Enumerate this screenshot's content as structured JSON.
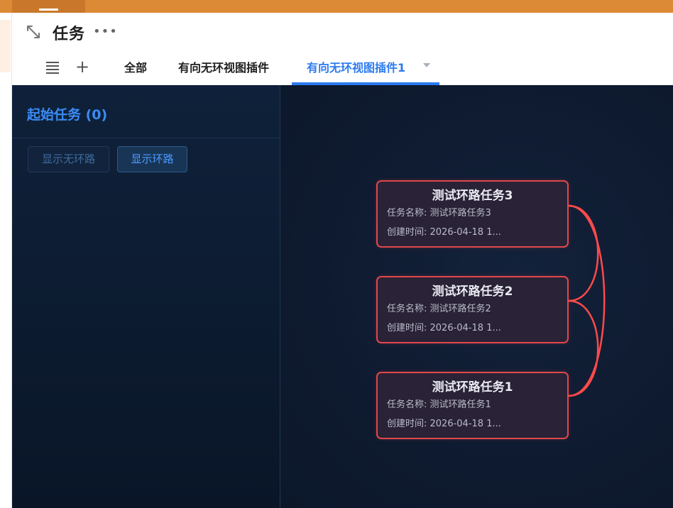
{
  "header": {
    "title": "任务",
    "more": "•••"
  },
  "tabs": [
    {
      "label": "全部",
      "active": false
    },
    {
      "label": "有向无环视图插件",
      "active": false
    },
    {
      "label": "有向无环视图插件1",
      "active": true
    }
  ],
  "left_panel": {
    "title": "起始任务 (0)",
    "buttons": {
      "show_noncycle": "显示无环路",
      "show_cycle": "显示环路"
    }
  },
  "graph": {
    "nodes": [
      {
        "title": "测试环路任务3",
        "name_line": "任务名称: 测试环路任务3",
        "time_line": "创建时间: 2026-04-18 1..."
      },
      {
        "title": "测试环路任务2",
        "name_line": "任务名称: 测试环路任务2",
        "time_line": "创建时间: 2026-04-18 1..."
      },
      {
        "title": "测试环路任务1",
        "name_line": "任务名称: 测试环路任务1",
        "time_line": "创建时间: 2026-04-18 1..."
      }
    ],
    "edges": [
      {
        "from": "测试环路任务3",
        "to": "测试环路任务2"
      },
      {
        "from": "测试环路任务2",
        "to": "测试环路任务1"
      },
      {
        "from": "测试环路任务1",
        "to": "测试环路任务3"
      }
    ],
    "edge_color": "#ff4a4a",
    "node_border_color": "#e0474b"
  },
  "colors": {
    "accent": "#2b7bf0",
    "topbar": "#dd8a36",
    "canvas_bg": "#0d1a2e"
  }
}
